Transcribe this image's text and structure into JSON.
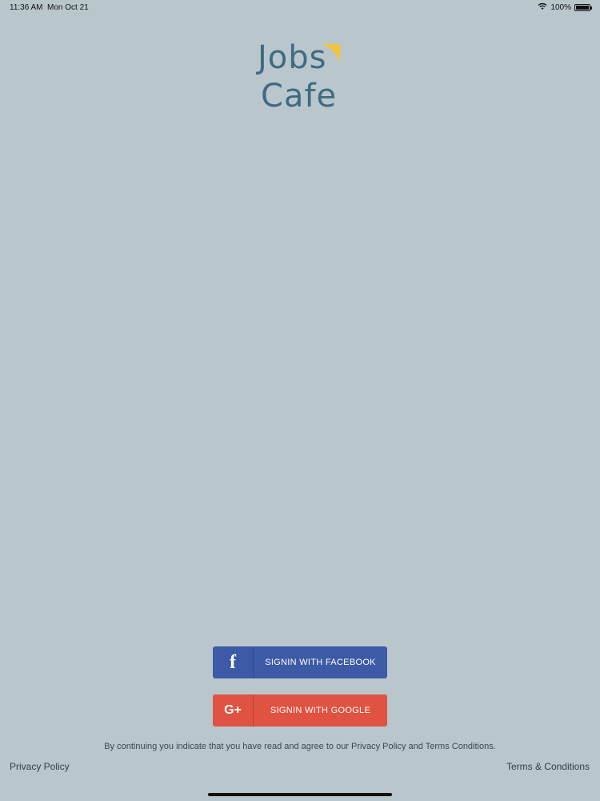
{
  "status_bar": {
    "time": "11:36 AM",
    "date": "Mon Oct 21",
    "battery": "100%",
    "battery_level": 1.0,
    "icons": [
      "wifi-icon",
      "battery-icon"
    ]
  },
  "logo": {
    "line1": "Jobs",
    "line2": "Cafe",
    "accent_color": "#f3c43a",
    "text_color": "#3e6b83"
  },
  "buttons": {
    "facebook": {
      "icon_text": "f",
      "label": "SIGNIN WITH FACEBOOK",
      "color": "#3c5aa5"
    },
    "google": {
      "icon_text": "G+",
      "label": "SIGNIN WITH GOOGLE",
      "color": "#e05241"
    }
  },
  "disclaimer": "By continuing  you indicate that you have read and agree to our Privacy Policy and Terms Conditions.",
  "footer": {
    "privacy": "Privacy Policy",
    "terms": "Terms & Conditions"
  },
  "colors": {
    "background": "#b9c7cc"
  }
}
